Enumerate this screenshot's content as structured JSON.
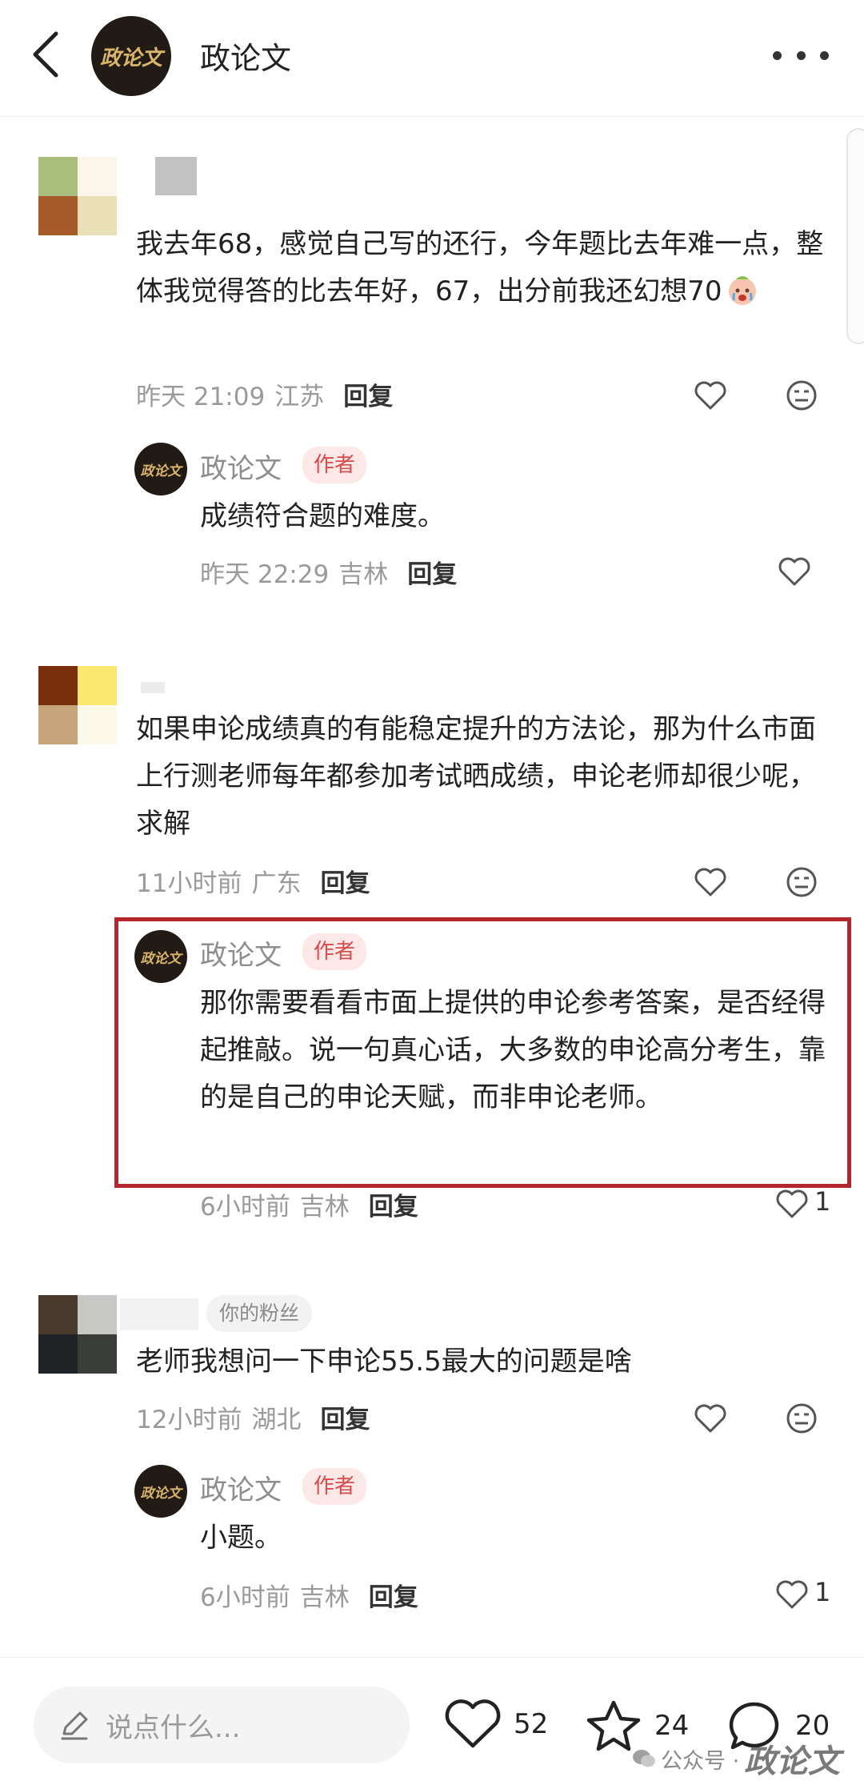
{
  "header": {
    "title": "政论文",
    "avatar_text": "政论文"
  },
  "comments": [
    {
      "text": "我去年68，感觉自己写的还行，今年题比去年难一点，整体我觉得答的比去年好，67，出分前我还幻想70",
      "time": "昨天 21:09",
      "location": "江苏",
      "reply_label": "回复",
      "reply": {
        "name": "政论文",
        "badge": "作者",
        "text": "成绩符合题的难度。",
        "time": "昨天 22:29",
        "location": "吉林",
        "reply_label": "回复"
      }
    },
    {
      "text": "如果申论成绩真的有能稳定提升的方法论，那为什么市面上行测老师每年都参加考试晒成绩，申论老师却很少呢，求解",
      "time": "11小时前",
      "location": "广东",
      "reply_label": "回复",
      "reply": {
        "name": "政论文",
        "badge": "作者",
        "text": "那你需要看看市面上提供的申论参考答案，是否经得起推敲。说一句真心话，大多数的申论高分考生，靠的是自己的申论天赋，而非申论老师。",
        "time": "6小时前",
        "location": "吉林",
        "reply_label": "回复",
        "likes": "1"
      }
    },
    {
      "fan_badge": "你的粉丝",
      "text": "老师我想问一下申论55.5最大的问题是啥",
      "time": "12小时前",
      "location": "湖北",
      "reply_label": "回复",
      "reply": {
        "name": "政论文",
        "badge": "作者",
        "text": "小题。",
        "time": "6小时前",
        "location": "吉林",
        "reply_label": "回复",
        "likes": "1"
      }
    }
  ],
  "bottom_bar": {
    "input_placeholder": "说点什么...",
    "likes": "52",
    "favorites": "24",
    "comments": "20"
  },
  "watermark": {
    "prefix": "公众号 ·",
    "name": "政论文"
  },
  "colors": {
    "author_badge": "#d94b4b",
    "highlight_border": "#b4262b",
    "avatar_bg": "#221a15",
    "avatar_text": "#d9b56c"
  }
}
